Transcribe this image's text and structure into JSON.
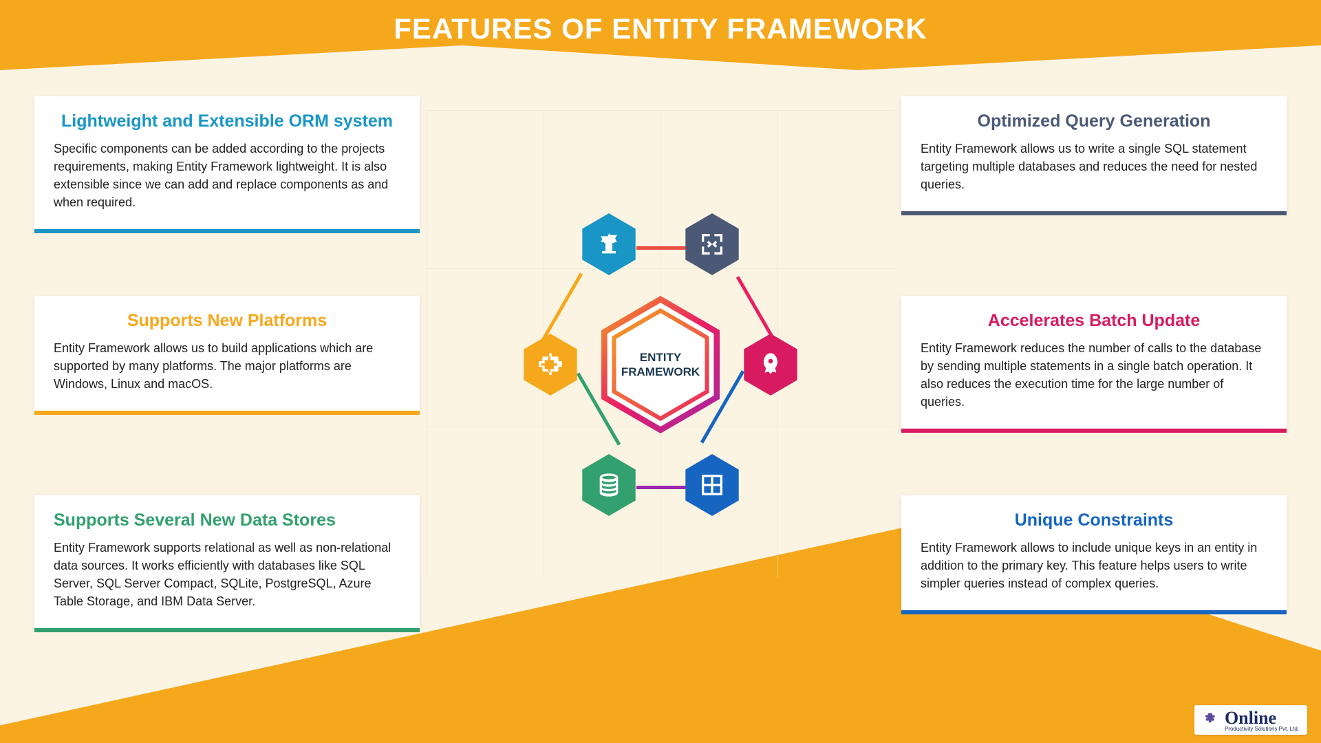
{
  "header": {
    "title": "FEATURES OF ENTITY FRAMEWORK"
  },
  "center": {
    "label": "ENTITY FRAMEWORK"
  },
  "nodes": {
    "tl": {
      "name": "scales-icon",
      "color": "#1996c5"
    },
    "tr": {
      "name": "expand-icon",
      "color": "#4b5977"
    },
    "l": {
      "name": "sitemap-icon",
      "color": "#F6A81D"
    },
    "r": {
      "name": "rocket-icon",
      "color": "#d81b60"
    },
    "bl": {
      "name": "database-icon",
      "color": "#33a06f"
    },
    "br": {
      "name": "grid-icon",
      "color": "#1665c1"
    }
  },
  "features": {
    "left": [
      {
        "title": "Lightweight and Extensible ORM system",
        "body": "Specific components can be added according to the projects requirements, making Entity Framework lightweight. It is also extensible since we can add and replace components as and when required.",
        "accent": "#1996c5"
      },
      {
        "title": "Supports New Platforms",
        "body": "Entity Framework allows us to build applications which are supported by many platforms. The major platforms are Windows, Linux and macOS.",
        "accent": "#F6A81D"
      },
      {
        "title": "Supports Several New Data Stores",
        "body": "Entity Framework supports relational as well as non-relational data sources. It works efficiently with databases like SQL Server, SQL Server Compact, SQLite, PostgreSQL, Azure Table Storage, and IBM Data Server.",
        "accent": "#33a06f"
      }
    ],
    "right": [
      {
        "title": "Optimized Query Generation",
        "body": "Entity Framework allows us to write a single SQL statement targeting multiple databases and reduces the need for nested queries.",
        "accent": "#4b5977"
      },
      {
        "title": "Accelerates Batch Update",
        "body": "Entity Framework reduces the number of calls to the database by sending multiple statements in a single batch operation. It also reduces the execution time for the large number of queries.",
        "accent": "#d81b60"
      },
      {
        "title": "Unique Constraints",
        "body": "Entity Framework allows to include unique keys in an entity in addition to the primary key. This feature helps users to write simpler queries instead of complex queries.",
        "accent": "#1665c1"
      }
    ]
  },
  "logo": {
    "brand": "Online",
    "subtitle": "Productivity Solutions Pvt. Ltd."
  }
}
